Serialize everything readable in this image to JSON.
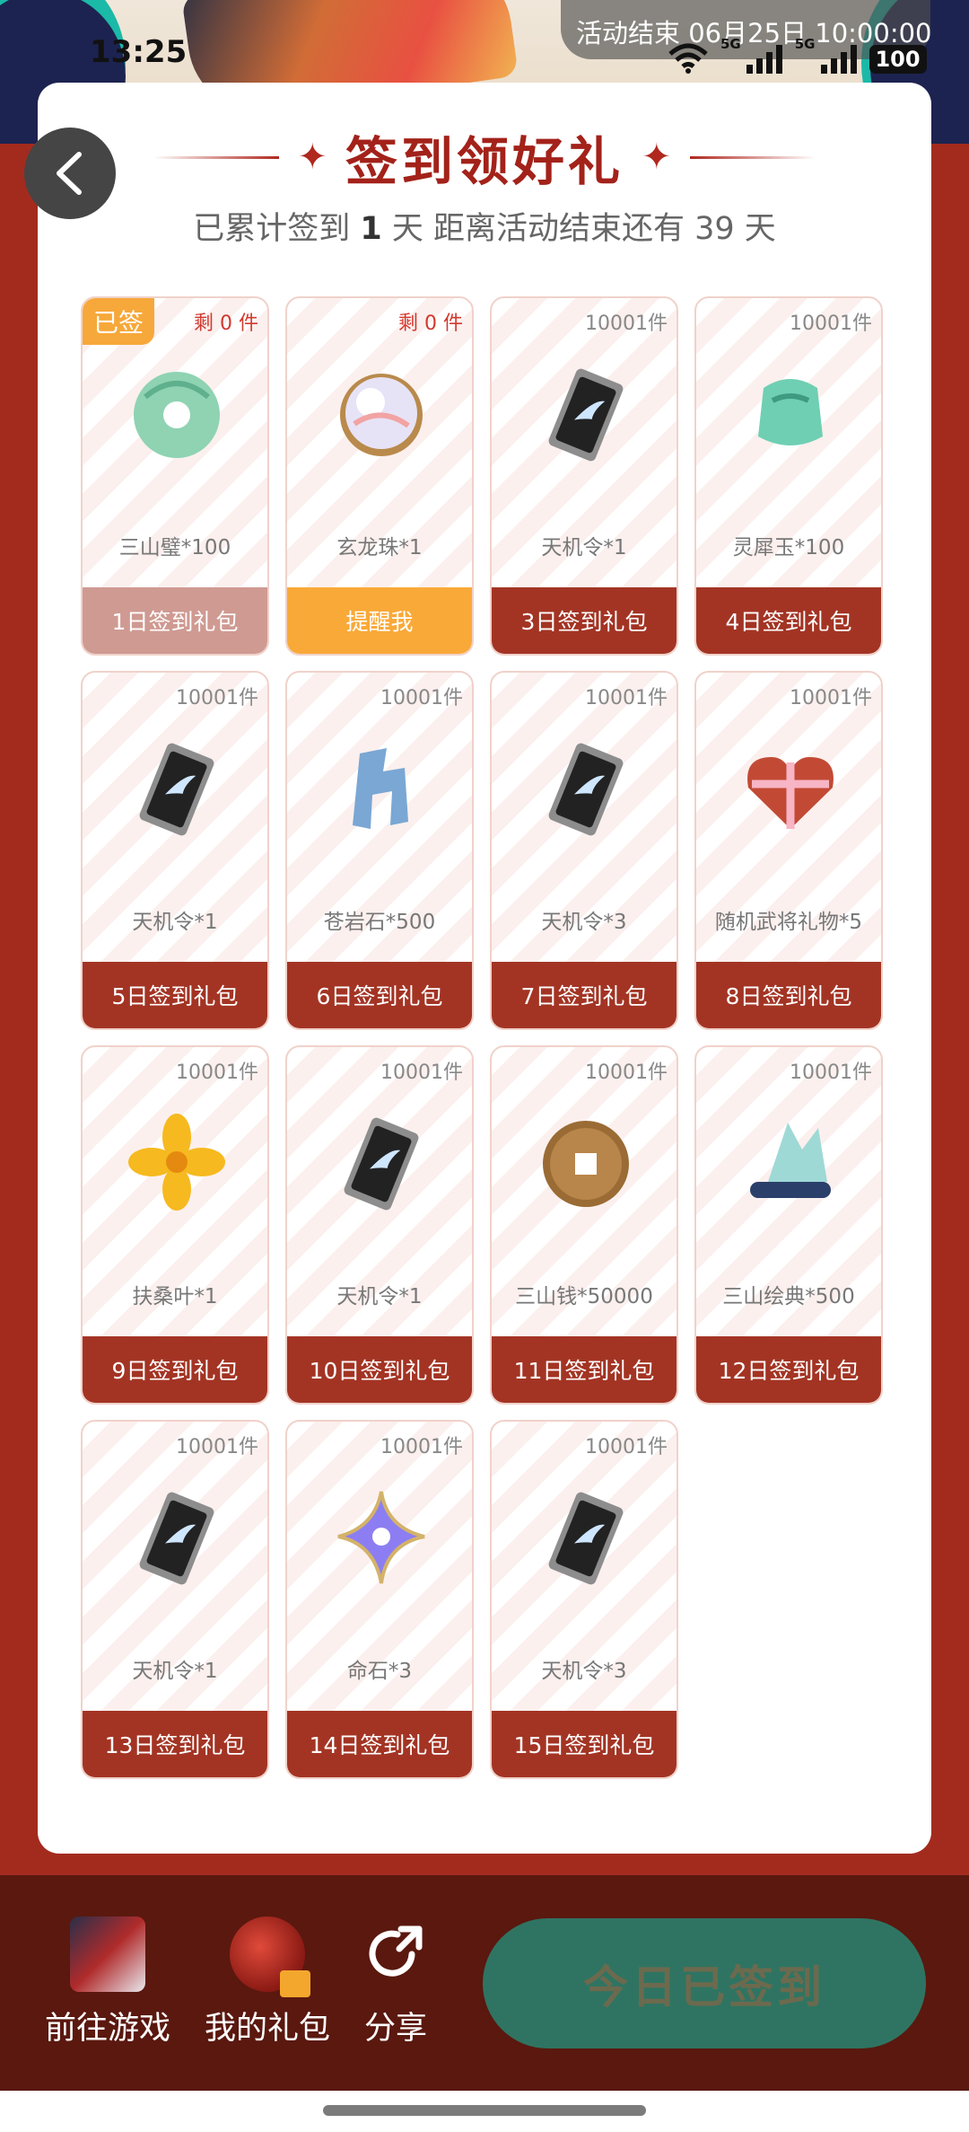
{
  "status_bar": {
    "time": "13:25",
    "activity_end_notice": "活动结束 06月25日 10:00:00",
    "network_badge": "5G",
    "battery": "100"
  },
  "header": {
    "title": "签到领好礼",
    "subtitle_prefix": "已累计签到",
    "signed_days": "1",
    "subtitle_mid": "天  距离活动结束还有 39 天"
  },
  "gifts": [
    {
      "stock": "剩 0 件",
      "stock_red": true,
      "name": "三山璧*100",
      "button": "1日签到礼包",
      "state": "signed",
      "signed_badge": "已签",
      "icon": "jade-disc-icon"
    },
    {
      "stock": "剩 0 件",
      "stock_red": true,
      "name": "玄龙珠*1",
      "button": "提醒我",
      "state": "remind",
      "icon": "pearl-icon"
    },
    {
      "stock": "10001件",
      "name": "天机令*1",
      "button": "3日签到礼包",
      "state": "normal",
      "icon": "token-icon"
    },
    {
      "stock": "10001件",
      "name": "灵犀玉*100",
      "button": "4日签到礼包",
      "state": "normal",
      "icon": "jade-icon"
    },
    {
      "stock": "10001件",
      "name": "天机令*1",
      "button": "5日签到礼包",
      "state": "normal",
      "icon": "token-icon"
    },
    {
      "stock": "10001件",
      "name": "苍岩石*500",
      "button": "6日签到礼包",
      "state": "normal",
      "icon": "rock-icon"
    },
    {
      "stock": "10001件",
      "name": "天机令*3",
      "button": "7日签到礼包",
      "state": "normal",
      "icon": "token-icon"
    },
    {
      "stock": "10001件",
      "name": "随机武将礼物*5",
      "button": "8日签到礼包",
      "state": "normal",
      "icon": "gift-heart-icon"
    },
    {
      "stock": "10001件",
      "name": "扶桑叶*1",
      "button": "9日签到礼包",
      "state": "normal",
      "icon": "flower-icon"
    },
    {
      "stock": "10001件",
      "name": "天机令*1",
      "button": "10日签到礼包",
      "state": "normal",
      "icon": "token-icon"
    },
    {
      "stock": "10001件",
      "name": "三山钱*50000",
      "button": "11日签到礼包",
      "state": "normal",
      "icon": "coin-icon"
    },
    {
      "stock": "10001件",
      "name": "三山绘典*500",
      "button": "12日签到礼包",
      "state": "normal",
      "icon": "scroll-icon"
    },
    {
      "stock": "10001件",
      "name": "天机令*1",
      "button": "13日签到礼包",
      "state": "normal",
      "icon": "token-icon"
    },
    {
      "stock": "10001件",
      "name": "命石*3",
      "button": "14日签到礼包",
      "state": "normal",
      "icon": "star-gem-icon"
    },
    {
      "stock": "10001件",
      "name": "天机令*3",
      "button": "15日签到礼包",
      "state": "normal",
      "icon": "token-icon"
    }
  ],
  "bottom_bar": {
    "go_game": "前往游戏",
    "my_gifts": "我的礼包",
    "share": "分享",
    "signed_today": "今日已签到"
  }
}
